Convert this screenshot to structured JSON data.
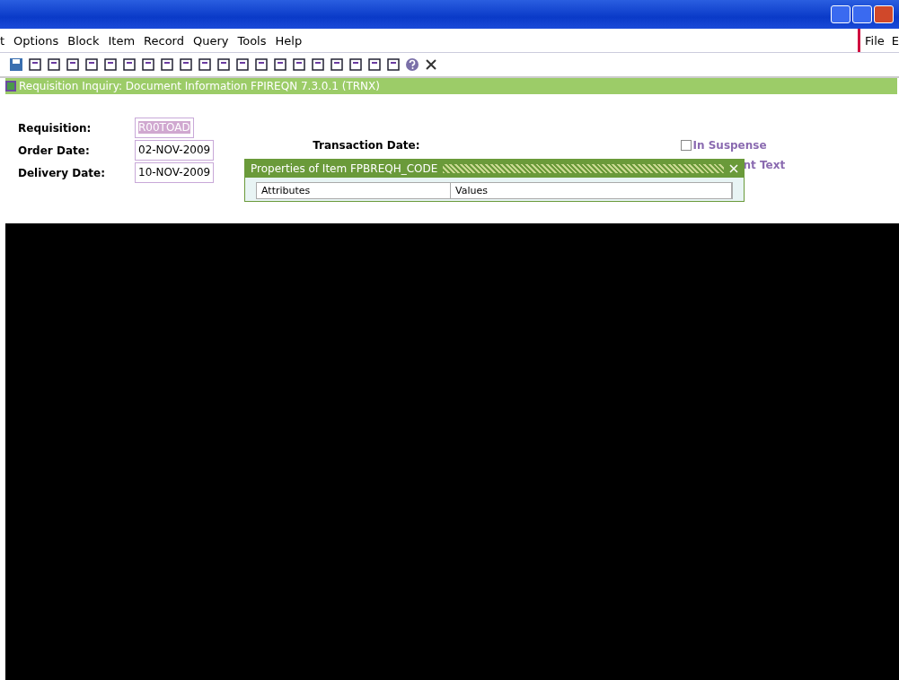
{
  "menu_bar": {
    "items": [
      "t",
      "Options",
      "Block",
      "Item",
      "Record",
      "Query",
      "Tools",
      "Help"
    ],
    "right_items": [
      "File",
      "E"
    ]
  },
  "form": {
    "title": "Requisition Inquiry: Document Information  FPIREQN  7.3.0.1  (TRNX)",
    "fields": [
      {
        "label": "Requisition:",
        "value": "R00TOAD",
        "selected": true
      },
      {
        "label": "Order Date:",
        "value": "02-NOV-2009",
        "selected": false
      },
      {
        "label": "Delivery Date:",
        "value": "10-NOV-2009",
        "selected": false
      }
    ],
    "transaction_date_label": "Transaction Date:",
    "suspense": {
      "label": "In Suspense",
      "checked": false
    },
    "document_text_label": "nt Text"
  },
  "dialog": {
    "title": "Properties of Item FPBREQH_CODE",
    "columns": [
      "Attributes",
      "Values"
    ]
  }
}
